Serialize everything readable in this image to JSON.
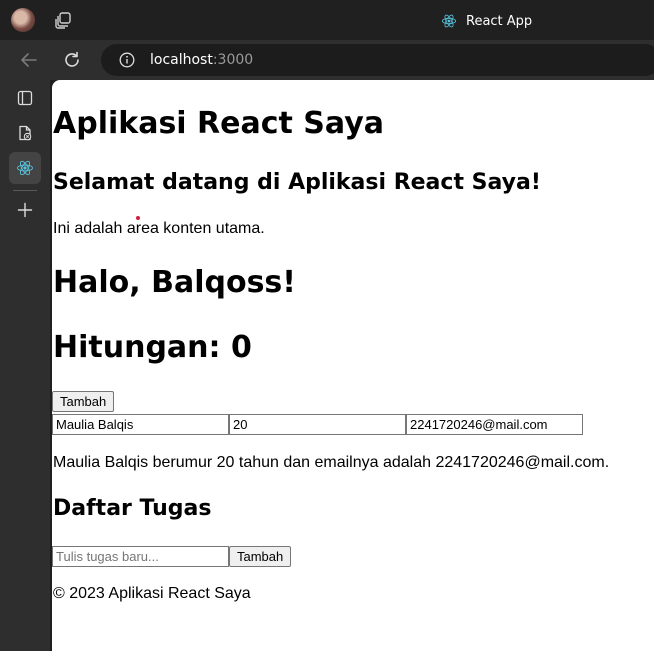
{
  "browser": {
    "tab_title": "React App",
    "url_host": "localhost",
    "url_port": ":3000"
  },
  "page": {
    "title": "Aplikasi React Saya",
    "welcome": "Selamat datang di Aplikasi React Saya!",
    "intro": "Ini adalah area konten utama.",
    "greeting": "Halo, Balqoss!",
    "counter": "Hitungan: 0",
    "add_button": "Tambah",
    "form": {
      "name_value": "Maulia Balqis",
      "age_value": "20",
      "email_value": "2241720246@mail.com"
    },
    "summary": "Maulia Balqis berumur 20 tahun dan emailnya adalah 2241720246@mail.com.",
    "todo_heading": "Daftar Tugas",
    "todo_placeholder": "Tulis tugas baru...",
    "todo_add_button": "Tambah",
    "footer": "© 2023 Aplikasi React Saya"
  },
  "colors": {
    "react_logo": "#58c4dc",
    "marker_dot": "#d02040"
  },
  "icons": {
    "collections": "collections-icon",
    "back": "back-arrow-icon",
    "refresh": "refresh-icon",
    "site_info": "info-icon",
    "sidebar_tabs": "tab-actions-icon",
    "sidebar_pdf": "document-icon",
    "sidebar_react": "react-logo-icon",
    "sidebar_add": "plus-icon"
  }
}
